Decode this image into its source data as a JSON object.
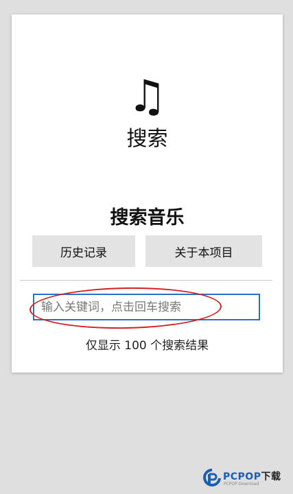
{
  "header": {
    "icon": "music-note-icon",
    "icon_glyph": "♫",
    "title": "搜索"
  },
  "main": {
    "heading": "搜索音乐",
    "buttons": {
      "history_label": "历史记录",
      "about_label": "关于本项目"
    },
    "search": {
      "placeholder": "输入关键词，点击回车搜索",
      "value": ""
    },
    "result_note": "仅显示 100 个搜索结果"
  },
  "watermark": {
    "brand": "PCPOP",
    "suffix": "下载",
    "sub": "PCPOP Download"
  },
  "colors": {
    "background": "#dfdfdf",
    "card": "#ffffff",
    "button": "#e3e3e3",
    "input_border": "#2a6fc7",
    "annotation": "#d42020",
    "brand": "#1a5fb4"
  }
}
